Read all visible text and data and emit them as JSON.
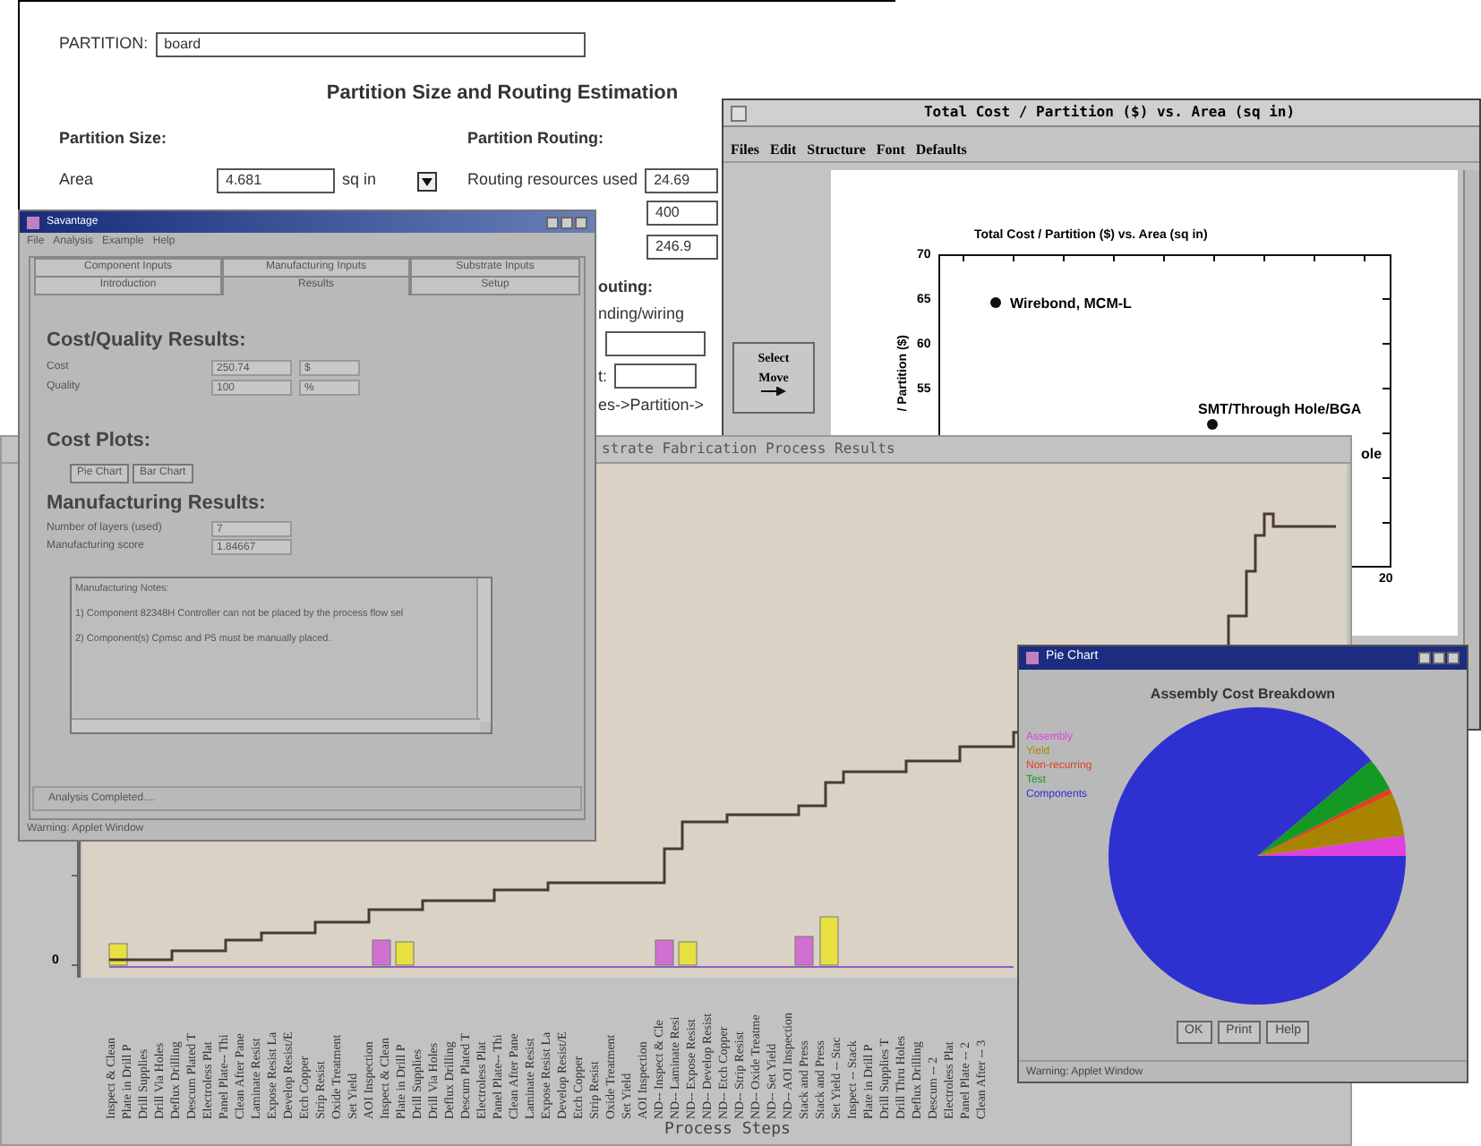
{
  "partition_window": {
    "partition_label": "PARTITION:",
    "partition_value": "board",
    "title": "Partition Size and Routing Estimation",
    "size_heading": "Partition Size:",
    "area_label": "Area",
    "area_value": "4.681",
    "area_unit": "sq in",
    "routing_heading": "Partition Routing:",
    "routing_label": "Routing resources used",
    "routing_value": "24.69",
    "right_values": [
      "400",
      "246.9"
    ],
    "lower_right": [
      {
        "kind": "heading",
        "text": "outing:"
      },
      {
        "kind": "text",
        "text": "nding/wiring"
      },
      {
        "kind": "field"
      },
      {
        "kind": "label_field",
        "text": "t:"
      },
      {
        "kind": "text",
        "text": "es->Partition->"
      }
    ]
  },
  "cost_window": {
    "title": "Total Cost / Partition ($) vs. Area (sq in)",
    "menu": [
      "Files",
      "Edit",
      "Structure",
      "Font",
      "Defaults"
    ],
    "palette": [
      "Select",
      "Move"
    ],
    "chart": {
      "title": "Total Cost / Partition ($) vs. Area (sq in)",
      "ylabel": "/ Partition ($)",
      "yticks": [
        "70",
        "65",
        "60",
        "55"
      ],
      "xtick": "20",
      "points": [
        {
          "label": "Wirebond, MCM-L"
        },
        {
          "label": "SMT/Through Hole/BGA"
        }
      ],
      "cut_label": "ole"
    }
  },
  "process_window": {
    "title": "strate Fabrication Process Results",
    "ytick": "0",
    "xlabel": "Process Steps",
    "steps": [
      "Inspect & Clean",
      "Plate in Drill P",
      "Drill Supplies",
      "Drill Via Holes",
      "Deflux Drilling",
      "Descum Plated T",
      "Electroless Plat",
      "Panel Plate-- Thi",
      "Clean After Pane",
      "Laminate Resist",
      "Expose Resist La",
      "Develop Resist/E",
      "Etch Copper",
      "Strip Resist",
      "Oxide Treatment",
      "Set Yield",
      "AOI Inspection",
      "Inspect & Clean",
      "Plate in Drill P",
      "Drill Supplies",
      "Drill Via Holes",
      "Deflux Drilling",
      "Descum Plated T",
      "Electroless Plat",
      "Panel Plate-- Thi",
      "Clean After Pane",
      "Laminate Resist",
      "Expose Resist La",
      "Develop Resist/E",
      "Etch Copper",
      "Strip Resist",
      "Oxide Treatment",
      "Set Yield",
      "AOI Inspection",
      "ND-- Inspect & Cle",
      "ND-- Laminate Resi",
      "ND-- Expose Resist",
      "ND-- Develop Resist",
      "ND-- Etch Copper",
      "ND-- Strip Resist",
      "ND-- Oxide Treatme",
      "ND-- Set Yield",
      "ND-- AOI Inspection",
      "Stack and Press",
      "Stack and Press",
      "Set Yield -- Stac",
      "Inspect -- Stack",
      "Plate in Drill P",
      "Drill Supplies T",
      "Drill Thru Holes",
      "Deflux Drilling",
      "Descum -- 2",
      "Electroless Plat",
      "Panel Plate -- 2",
      "Clean After -- 3"
    ]
  },
  "savantage_window": {
    "title": "Savantage",
    "menu": [
      "File",
      "Analysis",
      "Example",
      "Help"
    ],
    "tabs_back": [
      {
        "label": "Component Inputs"
      },
      {
        "label": "Manufacturing Inputs"
      },
      {
        "label": "Substrate Inputs"
      }
    ],
    "tabs_front": [
      {
        "label": "Introduction",
        "selected": false
      },
      {
        "label": "Results",
        "selected": true
      },
      {
        "label": "Setup",
        "selected": false
      }
    ],
    "cost_heading": "Cost/Quality Results:",
    "results": [
      {
        "label": "Cost",
        "value": "250.74",
        "unit": "$"
      },
      {
        "label": "Quality",
        "value": "100",
        "unit": "%"
      }
    ],
    "plots_heading": "Cost Plots:",
    "plot_buttons": [
      "Pie Chart",
      "Bar Chart"
    ],
    "mfg_heading": "Manufacturing Results:",
    "mfg_results": [
      {
        "label": "Number of layers (used)",
        "value": "7"
      },
      {
        "label": "Manufacturing score",
        "value": "1.84667"
      }
    ],
    "notes": [
      "Manufacturing Notes:",
      "1) Component 82348H Controller can not be placed by the process flow sel",
      "2) Component(s) Cpmsc and P5 must be manually placed."
    ],
    "status": "Analysis Completed....",
    "warning": "Warning: Applet Window"
  },
  "pie_window": {
    "title": "Pie Chart",
    "chart_title": "Assembly Cost Breakdown",
    "legend": [
      {
        "label": "Assembly",
        "color": "#e040e0"
      },
      {
        "label": "Yield",
        "color": "#a88400"
      },
      {
        "label": "Non-recurring",
        "color": "#e04020"
      },
      {
        "label": "Test",
        "color": "#149a24"
      },
      {
        "label": "Components",
        "color": "#2e30d0"
      }
    ],
    "buttons": [
      "OK",
      "Print",
      "Help"
    ],
    "warning": "Warning: Applet Window"
  }
}
